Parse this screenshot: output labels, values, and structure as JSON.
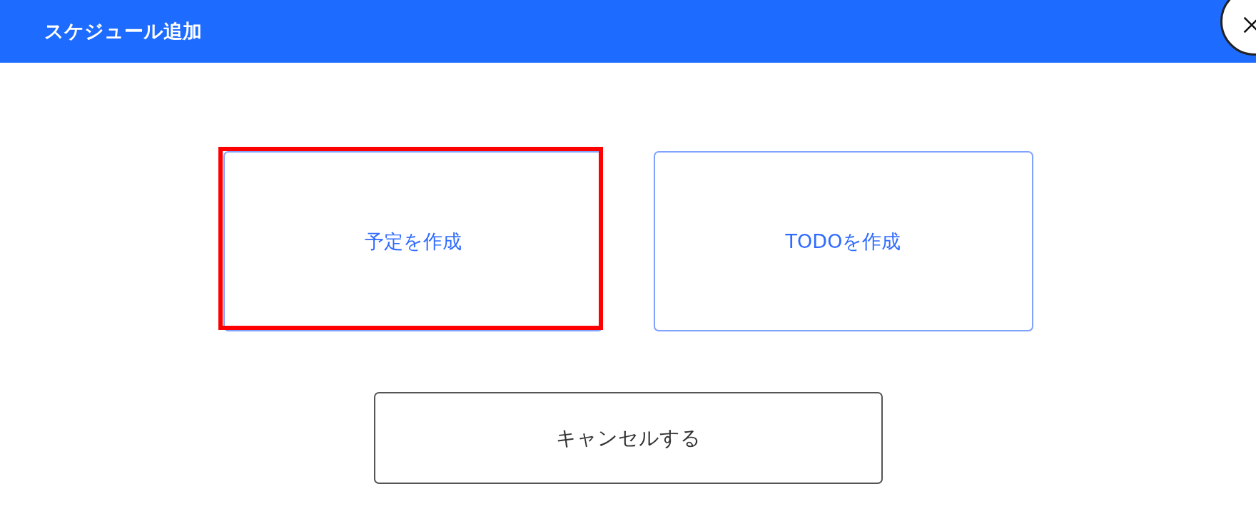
{
  "dialog": {
    "title": "スケジュール追加"
  },
  "choices": [
    {
      "label": "予定を作成",
      "highlighted": true
    },
    {
      "label": "TODOを作成",
      "highlighted": false
    }
  ],
  "cancel_button": {
    "label": "キャンセルする"
  }
}
